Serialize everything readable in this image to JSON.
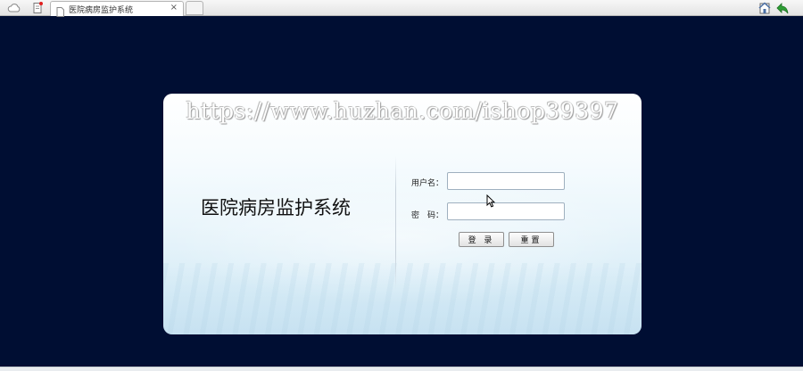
{
  "browser": {
    "tab_title": "医院病房监护系统",
    "tab_close": "×",
    "icons": [
      "cloud-icon",
      "notes-icon",
      "page-icon",
      "home-icon",
      "back-arrow-icon"
    ]
  },
  "login": {
    "watermark": "https://www.huzhan.com/ishop39397",
    "system_title": "医院病房监护系统",
    "username_label": "用户名：",
    "username_value": "",
    "password_label": "密　码：",
    "password_value": "",
    "login_button": "登 录",
    "reset_button": "重置"
  },
  "colors": {
    "background": "#000e33",
    "accent_green": "#2e9e35"
  }
}
